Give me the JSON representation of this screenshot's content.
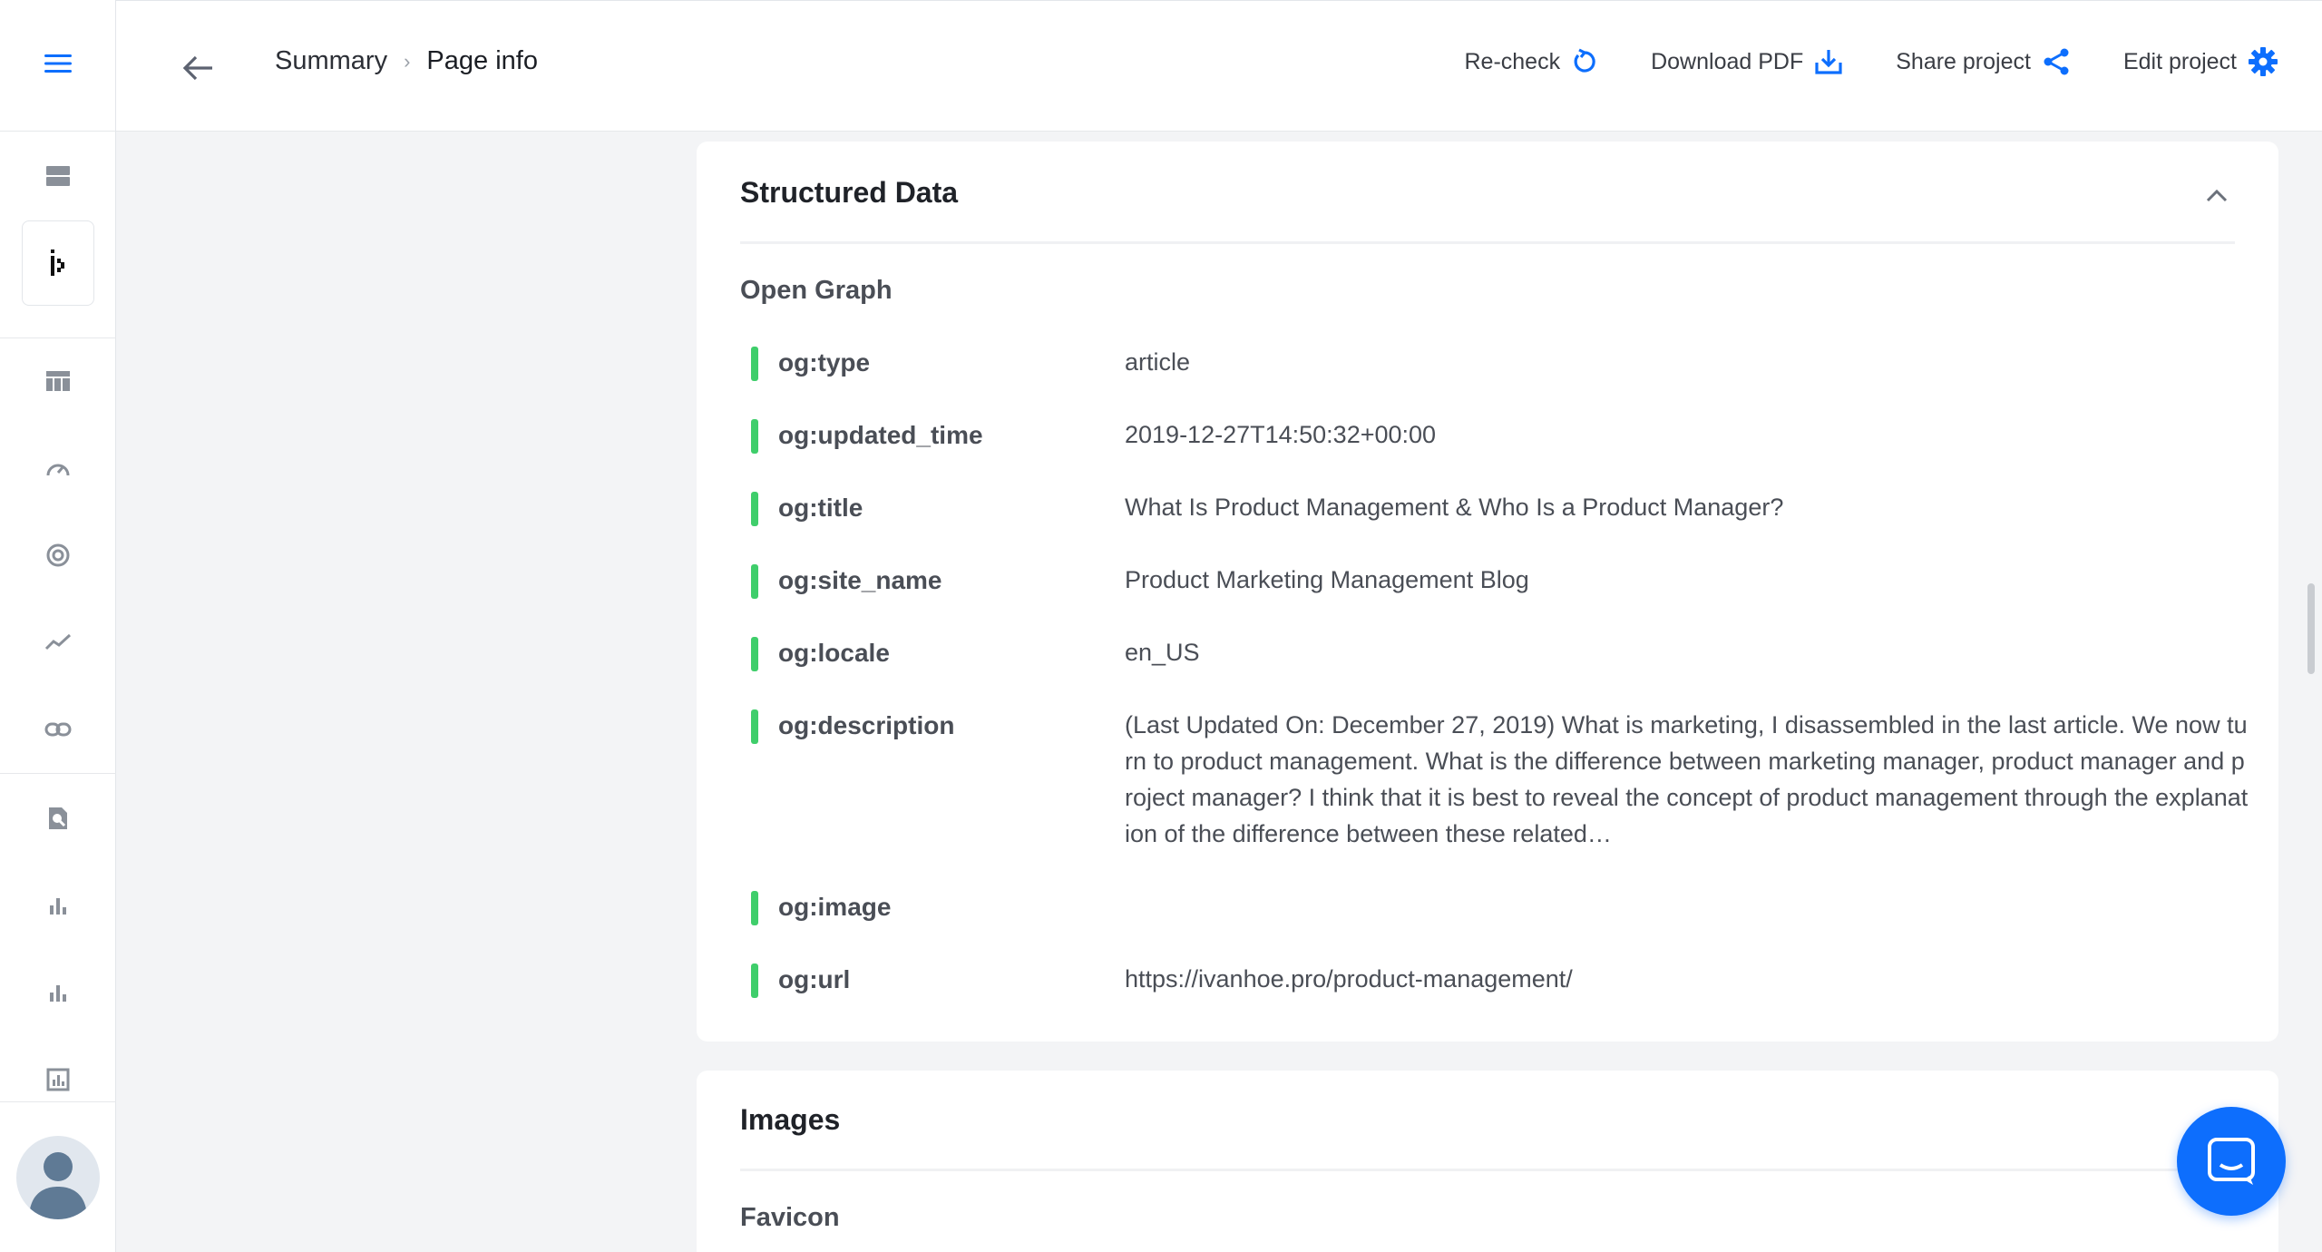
{
  "breadcrumb": {
    "parent": "Summary",
    "separator": "›",
    "current": "Page info"
  },
  "actions": {
    "recheck": "Re-check",
    "download_pdf": "Download PDF",
    "share_project": "Share project",
    "edit_project": "Edit project"
  },
  "structured_data": {
    "title": "Structured Data",
    "section": "Open Graph",
    "rows": [
      {
        "key": "og:type",
        "value": "article"
      },
      {
        "key": "og:updated_time",
        "value": "2019-12-27T14:50:32+00:00"
      },
      {
        "key": "og:title",
        "value": "What Is Product Management & Who Is a Product Manager?"
      },
      {
        "key": "og:site_name",
        "value": "Product Marketing Management Blog"
      },
      {
        "key": "og:locale",
        "value": "en_US"
      },
      {
        "key": "og:description",
        "value": "(Last Updated On: December 27, 2019)  What is marketing, I disassembled in the last article. We now turn to product management. What is the difference between marketing manager, product manager and project manager? I think that it is best to reveal the concept of product management through the explanation of the difference between these related…"
      },
      {
        "key": "og:image",
        "value": ""
      },
      {
        "key": "og:url",
        "value": "https://ivanhoe.pro/product-management/"
      }
    ]
  },
  "images": {
    "title": "Images",
    "section": "Favicon"
  },
  "colors": {
    "accent": "#0d6efd",
    "status_ok": "#3fce6b",
    "sidebar_icon": "#8a9099"
  },
  "icons": {
    "menu": "hamburger-icon",
    "back": "arrow-left-icon",
    "recheck": "refresh-icon",
    "download": "download-icon",
    "share": "share-icon",
    "edit": "gear-icon",
    "collapse": "chevron-up-icon",
    "chat": "chat-icon"
  }
}
